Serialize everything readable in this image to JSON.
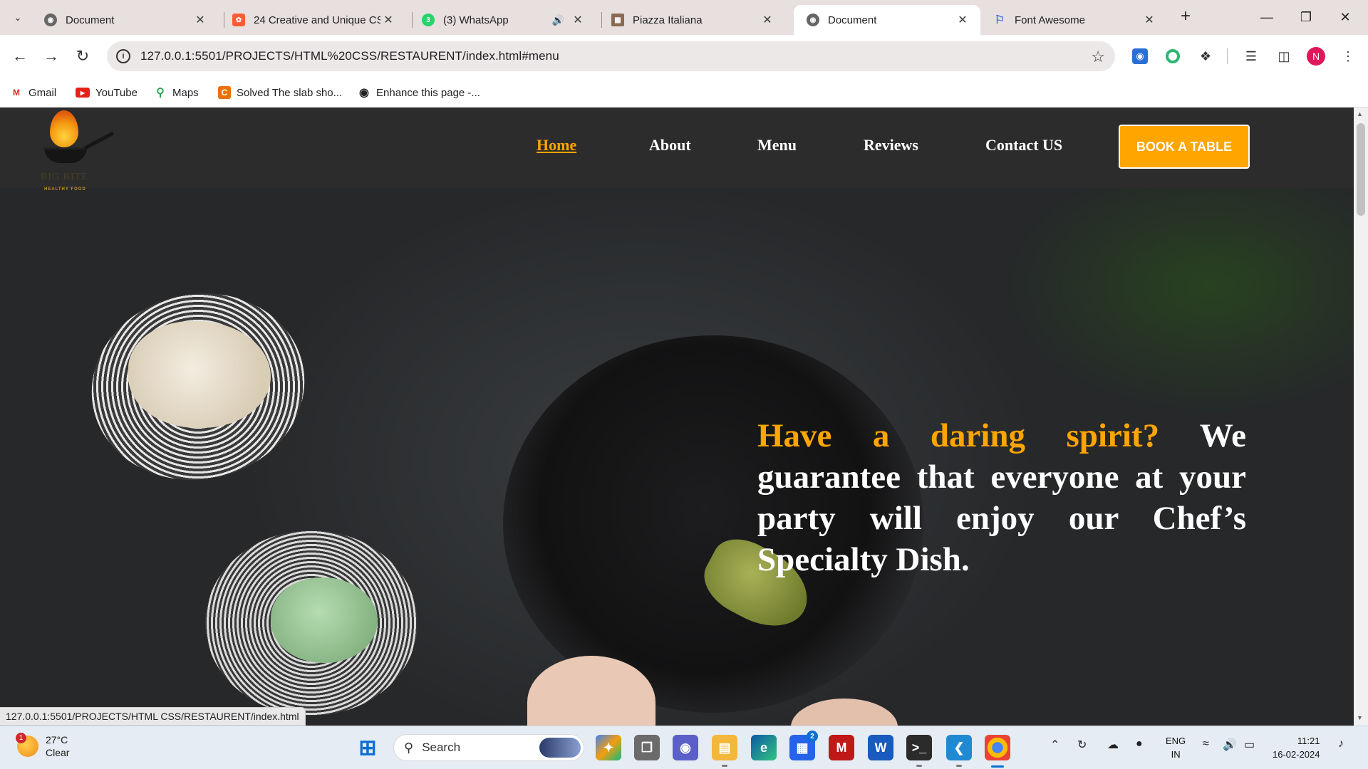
{
  "tabs": [
    {
      "title": "Document",
      "icon": "globe-icon",
      "active": false
    },
    {
      "title": "24 Creative and Unique CS",
      "icon": "hubspot-icon",
      "active": false
    },
    {
      "title": "(3) WhatsApp",
      "icon": "whatsapp-icon",
      "badge": "3",
      "active": false,
      "audio": true
    },
    {
      "title": "Piazza Italiana",
      "icon": "building-icon",
      "active": false
    },
    {
      "title": "Document",
      "icon": "globe-icon",
      "active": true
    },
    {
      "title": "Font Awesome",
      "icon": "flag-icon",
      "active": false
    }
  ],
  "address_bar": {
    "url": "127.0.0.1:5501/PROJECTS/HTML%20CSS/RESTAURENT/index.html#menu"
  },
  "profile": {
    "initial": "N"
  },
  "bookmarks": [
    {
      "label": "Gmail",
      "icon": "gmail-icon"
    },
    {
      "label": "YouTube",
      "icon": "youtube-icon"
    },
    {
      "label": "Maps",
      "icon": "maps-icon"
    },
    {
      "label": "Solved The slab sho...",
      "icon": "chegg-icon"
    },
    {
      "label": "Enhance this page -...",
      "icon": "globe-icon"
    }
  ],
  "site": {
    "logo": {
      "name": "BIG BITE",
      "tagline": "HEALTHY FOOD"
    },
    "nav": [
      {
        "label": "Home",
        "active": true
      },
      {
        "label": "About",
        "active": false
      },
      {
        "label": "Menu",
        "active": false
      },
      {
        "label": "Reviews",
        "active": false
      },
      {
        "label": "Contact US",
        "active": false
      }
    ],
    "cta": "BOOK A TABLE",
    "hero": {
      "accent": "Have a daring spirit?",
      "rest": "We guarantee that everyone at your party will enjoy our Chef’s Specialty Dish."
    },
    "accent_color": "#ffa500"
  },
  "status_bar": {
    "link": "127.0.0.1:5501/PROJECTS/HTML CSS/RESTAURENT/index.html"
  },
  "taskbar": {
    "weather": {
      "temp": "27°C",
      "condition": "Clear",
      "badge": "1"
    },
    "search_placeholder": "Search",
    "store_badge": "2",
    "language": {
      "line1": "ENG",
      "line2": "IN"
    },
    "time": "11:21",
    "date": "16-02-2024"
  }
}
